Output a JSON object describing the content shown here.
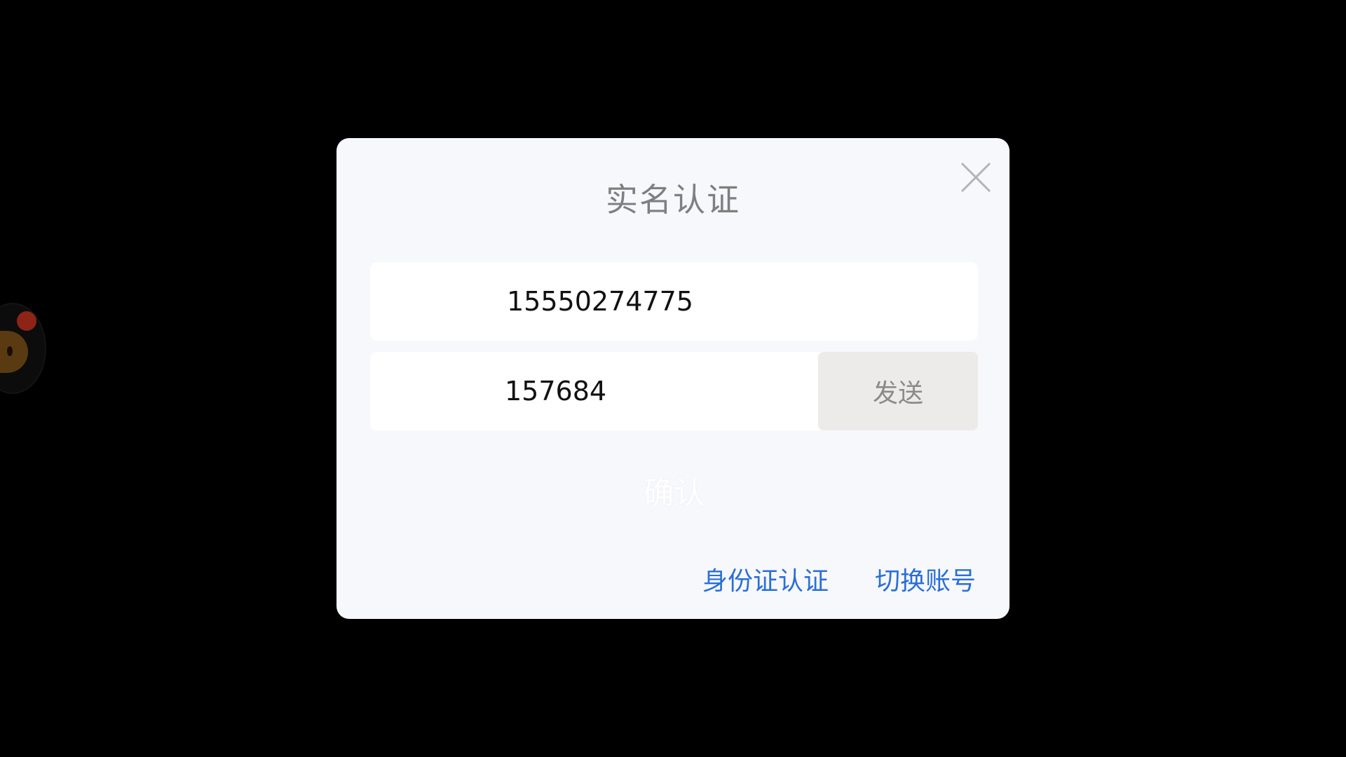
{
  "dialog": {
    "title": "实名认证",
    "phone_value": "15550274775",
    "code_value": "157684",
    "send_label": "发送",
    "confirm_label": "确认",
    "id_auth_label": "身份证认证",
    "switch_account_label": "切换账号"
  },
  "colors": {
    "backdrop": "#000000",
    "dialog_bg": "#f7f8fc",
    "link": "#2a6fd6",
    "send_bg": "#ecebe9"
  },
  "icons": {
    "close": "close-icon",
    "floating_assistant": "floating-assistant-icon"
  }
}
